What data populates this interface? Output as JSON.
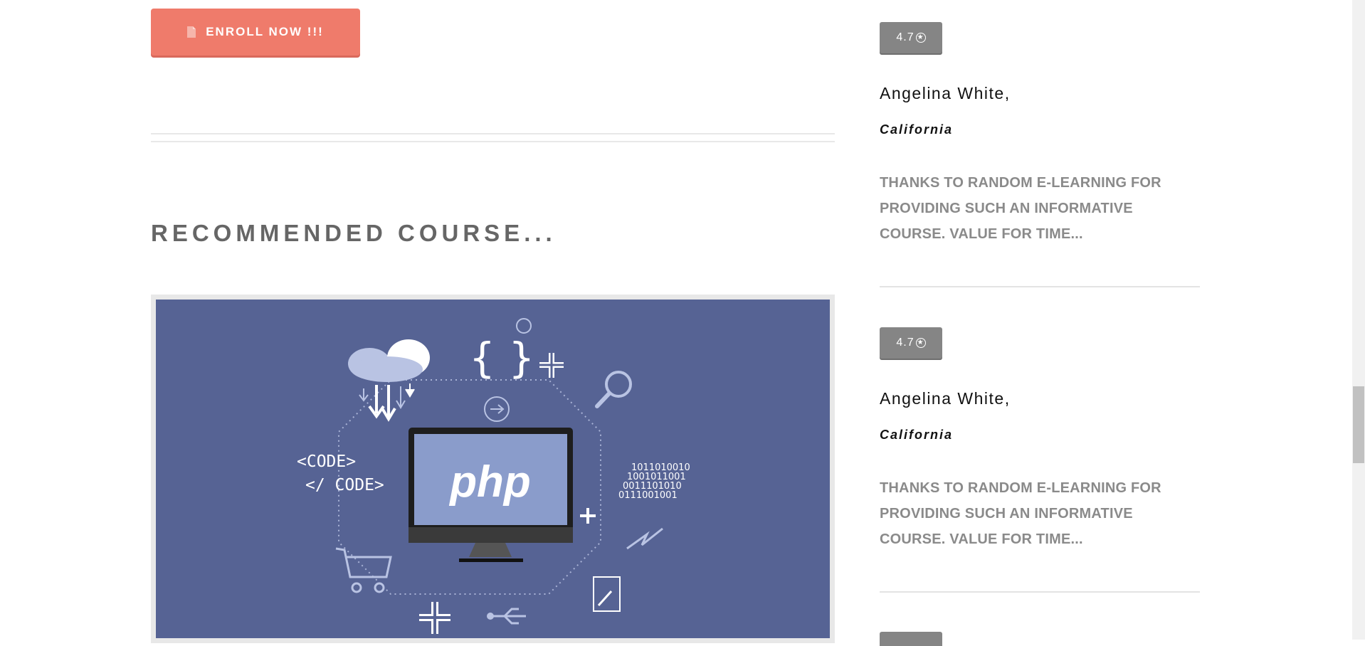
{
  "enroll_button": {
    "label": "ENROLL NOW !!!",
    "icon": "document-icon"
  },
  "section_title": "RECOMMENDED COURSE...",
  "course_image": {
    "php_label": "php",
    "code_open": "<CODE>",
    "code_close": "</ CODE>",
    "binary": [
      "1011010010",
      "1001011001",
      "0011101010",
      "0111001001"
    ],
    "background_color": "#566394"
  },
  "reviews": [
    {
      "rating": "4.7",
      "rating_icon": "star-circle-icon",
      "name": "Angelina White,",
      "location": "California",
      "text": "THANKS TO RANDOM E-LEARNING FOR PROVIDING SUCH AN INFORMATIVE COURSE. VALUE FOR TIME..."
    },
    {
      "rating": "4.7",
      "rating_icon": "star-circle-icon",
      "name": "Angelina White,",
      "location": "California",
      "text": "THANKS TO RANDOM E-LEARNING FOR PROVIDING SUCH AN INFORMATIVE COURSE. VALUE FOR TIME..."
    }
  ],
  "colors": {
    "accent": "#ef7b6b",
    "badge": "#858585",
    "muted_text": "#8a8a8a"
  }
}
